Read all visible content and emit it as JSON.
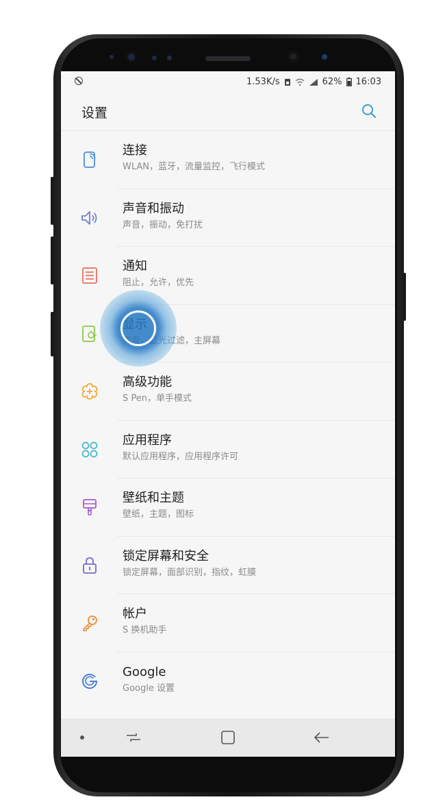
{
  "status_bar": {
    "speed": "1.53K/s",
    "battery": "62%",
    "time": "16:03"
  },
  "header": {
    "title": "设置"
  },
  "items": [
    {
      "title": "连接",
      "subtitle": "WLAN，蓝牙，流量监控，飞行模式",
      "icon": "connection-icon",
      "color": "#4a8fd6"
    },
    {
      "title": "声音和振动",
      "subtitle": "声音，振动，免打扰",
      "icon": "sound-icon",
      "color": "#6b7fd6"
    },
    {
      "title": "通知",
      "subtitle": "阻止，允许，优先",
      "icon": "notification-icon",
      "color": "#e8705a"
    },
    {
      "title": "显示",
      "subtitle": "亮度，蓝光过滤，主屏幕",
      "icon": "display-icon",
      "color": "#8cc84b"
    },
    {
      "title": "高级功能",
      "subtitle": "S Pen，单手模式",
      "icon": "advanced-features-icon",
      "color": "#f0a830"
    },
    {
      "title": "应用程序",
      "subtitle": "默认应用程序，应用程序许可",
      "icon": "apps-icon",
      "color": "#3fb6c8"
    },
    {
      "title": "壁纸和主题",
      "subtitle": "壁纸，主题，图标",
      "icon": "theme-brush-icon",
      "color": "#a35ac8"
    },
    {
      "title": "锁定屏幕和安全",
      "subtitle": "锁定屏幕，面部识别，指纹，虹膜",
      "icon": "lock-icon",
      "color": "#7b66c8"
    },
    {
      "title": "帐户",
      "subtitle": "S 换机助手",
      "icon": "key-icon",
      "color": "#f08c3a"
    },
    {
      "title": "Google",
      "subtitle": "Google 设置",
      "icon": "google-icon",
      "color": "#4a7fd6"
    }
  ],
  "navigation": {
    "icons": [
      "dot-icon",
      "recents-icon",
      "home-icon",
      "back-icon"
    ]
  },
  "colors": {
    "accent": "#3aa0c8",
    "touch_highlight": "#2578c3"
  }
}
